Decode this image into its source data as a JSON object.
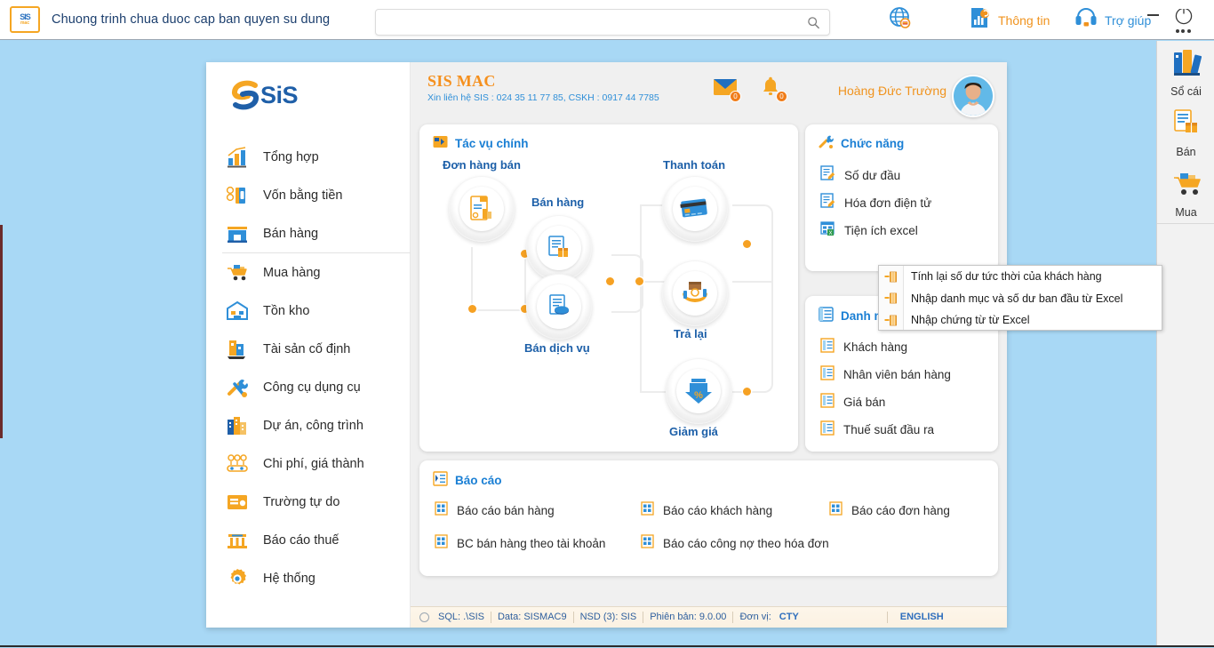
{
  "titlebar": {
    "logo_top": "SIS",
    "logo_bottom": "mac",
    "title": "Chuong trinh chua duoc cap ban quyen su dung",
    "search_placeholder": "",
    "search_value": "",
    "search_icon": "search-icon",
    "lang_icon": "globe-language-icon",
    "info_label": "Thông tin",
    "info_icon": "info-report-icon",
    "help_label": "Trợ giúp",
    "help_icon": "headset-help-icon",
    "minimize_icon": "minimize-icon",
    "power_icon": "power-icon",
    "more_icon": "more-dots-icon"
  },
  "sidebar": {
    "logo": "SiS",
    "items": [
      {
        "label": "Tổng hợp",
        "icon": "chart-bars-icon"
      },
      {
        "label": "Vốn bằng tiền",
        "icon": "cash-money-icon"
      },
      {
        "label": "Bán hàng",
        "icon": "store-sell-icon"
      },
      {
        "label": "Mua hàng",
        "icon": "cart-purchase-icon"
      },
      {
        "label": "Tồn kho",
        "icon": "warehouse-icon"
      },
      {
        "label": "Tài sản cố định",
        "icon": "fixed-asset-icon"
      },
      {
        "label": "Công cụ dụng cụ",
        "icon": "tools-icon"
      },
      {
        "label": "Dự án, công trình",
        "icon": "buildings-icon"
      },
      {
        "label": "Chi phí, giá thành",
        "icon": "cost-gauge-icon"
      },
      {
        "label": "Trường tự do",
        "icon": "free-field-icon"
      },
      {
        "label": "Báo cáo thuế",
        "icon": "bank-tax-icon"
      },
      {
        "label": "Hệ thống",
        "icon": "gear-icon"
      }
    ]
  },
  "header": {
    "brand_name": "SIS MAC",
    "brand_contact": "Xin liên hệ SIS : 024 35 11 77 85, CSKH : 0917 44 7785",
    "mail_icon": "mail-icon",
    "mail_count": "0",
    "bell_icon": "bell-icon",
    "bell_count": "0",
    "user_name": "Hoàng Đức Trường",
    "avatar": "user-avatar"
  },
  "main_tasks": {
    "title": "Tác vụ chính",
    "title_icon": "tasks-icon",
    "nodes": [
      {
        "label": "Đơn hàng bán",
        "icon": "sales-order-icon"
      },
      {
        "label": "Bán hàng",
        "icon": "sell-goods-icon"
      },
      {
        "label": "Bán dịch vụ",
        "icon": "sell-service-icon"
      },
      {
        "label": "Thanh toán",
        "icon": "payment-card-icon"
      },
      {
        "label": "Trả lại",
        "icon": "return-goods-icon"
      },
      {
        "label": "Giảm giá",
        "icon": "discount-icon"
      }
    ]
  },
  "functions": {
    "title": "Chức năng",
    "title_icon": "functions-icon",
    "items": [
      {
        "label": "Số dư đầu",
        "icon": "edit-doc-icon"
      },
      {
        "label": "Hóa đơn điện tử",
        "icon": "edit-doc-icon"
      },
      {
        "label": "Tiện ích excel",
        "icon": "excel-icon"
      }
    ]
  },
  "context_menu": {
    "items": [
      {
        "label": "Tính lại số dư tức thời của khách hàng",
        "icon": "excel-row-icon"
      },
      {
        "label": "Nhập danh mục và số dư ban đầu từ Excel",
        "icon": "excel-row-icon"
      },
      {
        "label": "Nhập chứng từ từ Excel",
        "icon": "excel-row-icon"
      }
    ]
  },
  "catalog": {
    "title": "Danh mục",
    "title_icon": "list-icon",
    "items": [
      {
        "label": "Khách hàng",
        "icon": "list-item-icon"
      },
      {
        "label": "Nhân viên bán hàng",
        "icon": "list-item-icon"
      },
      {
        "label": "Giá bán",
        "icon": "list-item-icon"
      },
      {
        "label": "Thuế suất đầu ra",
        "icon": "list-item-icon"
      }
    ]
  },
  "reports": {
    "title": "Báo cáo",
    "title_icon": "report-icon",
    "items": [
      {
        "label": "Báo cáo bán hàng",
        "icon": "report-grid-icon"
      },
      {
        "label": "Báo cáo khách hàng",
        "icon": "report-grid-icon"
      },
      {
        "label": "Báo cáo đơn hàng",
        "icon": "report-grid-icon"
      },
      {
        "label": "BC bán hàng theo tài khoản",
        "icon": "report-grid-icon"
      },
      {
        "label": "Báo cáo công nợ theo hóa đơn",
        "icon": "report-grid-icon"
      }
    ]
  },
  "statusbar": {
    "sql": "SQL: .\\SIS",
    "data": "Data: SISMAC9",
    "nsd": "NSD (3): SIS",
    "version": "Phiên bản: 9.0.00",
    "unit_label": "Đơn vị:",
    "unit_value": "CTY",
    "language": "ENGLISH"
  },
  "right_rail": {
    "items": [
      {
        "label": "Sổ cái",
        "icon": "ledger-icon"
      },
      {
        "label": "Bán",
        "icon": "sell-icon"
      },
      {
        "label": "Mua",
        "icon": "buy-cart-icon"
      }
    ]
  },
  "colors": {
    "accent_orange": "#f5901e",
    "accent_blue": "#1a7fd4",
    "desktop_blue": "#a8d8f5",
    "panel_gray": "#f0f0f0"
  }
}
